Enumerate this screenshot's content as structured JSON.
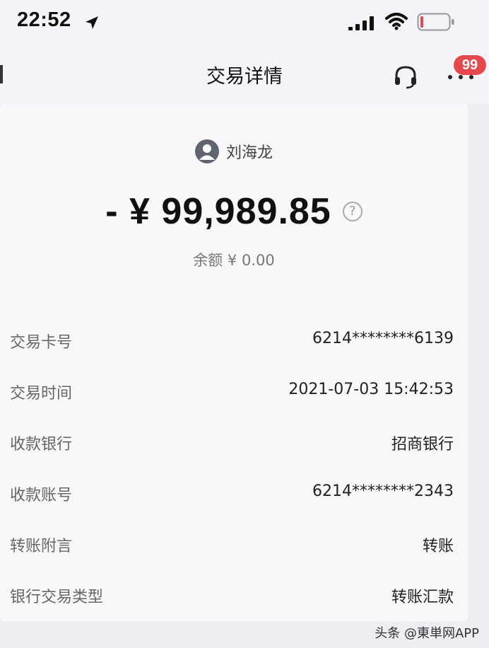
{
  "status_bar": {
    "time": "22:52"
  },
  "nav": {
    "title": "交易详情",
    "badge": "99"
  },
  "transaction": {
    "payee_name": "刘海龙",
    "amount": "- ¥ 99,989.85",
    "help_symbol": "?",
    "balance": "余额 ¥ 0.00"
  },
  "details": [
    {
      "label": "交易卡号",
      "value": "6214********6139"
    },
    {
      "label": "交易时间",
      "value": "2021-07-03 15:42:53"
    },
    {
      "label": "收款银行",
      "value": "招商银行"
    },
    {
      "label": "收款账号",
      "value": "6214********2343"
    },
    {
      "label": "转账附言",
      "value": "转账"
    },
    {
      "label": "银行交易类型",
      "value": "转账汇款"
    }
  ],
  "watermark": "头条 @東単网APP",
  "colors": {
    "background": "#ededf2",
    "card": "#f8f8fb",
    "badge": "#e5484d",
    "text_primary": "#111111",
    "text_secondary": "#666666"
  },
  "icons": [
    "location-arrow-icon",
    "signal-icon",
    "wifi-icon",
    "battery-icon",
    "headset-icon",
    "more-icon",
    "avatar-icon",
    "help-icon"
  ]
}
